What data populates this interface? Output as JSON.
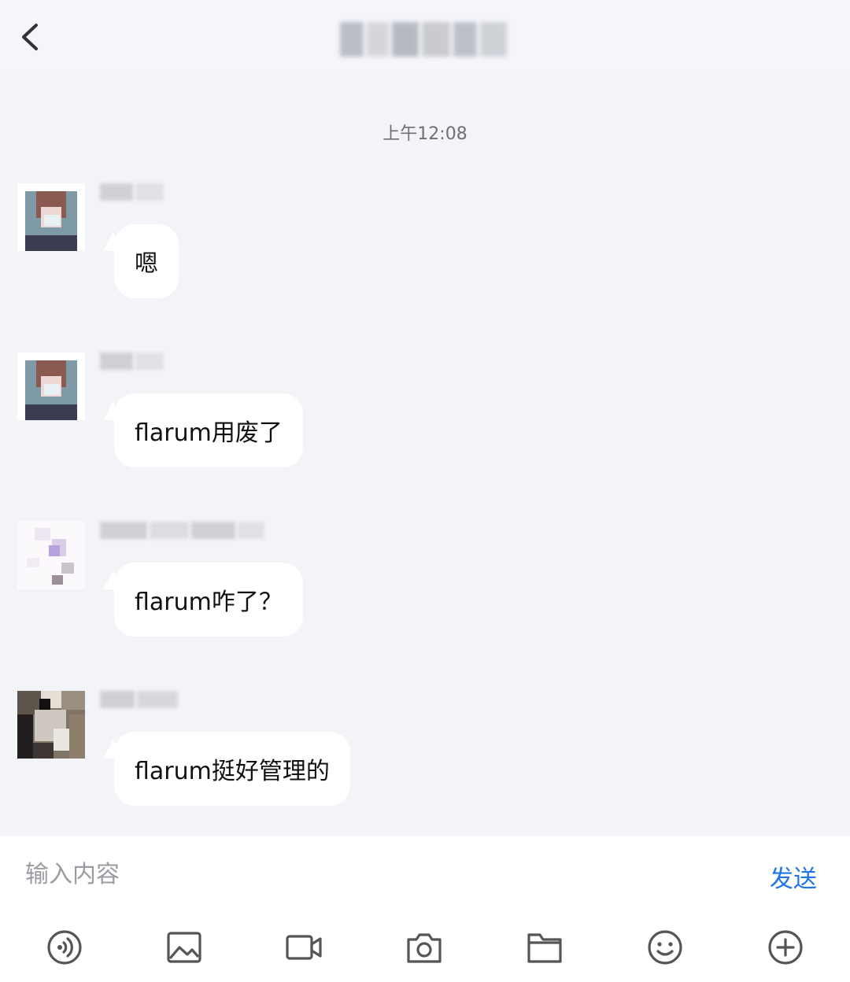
{
  "header": {
    "back_icon": "chevron-left-icon",
    "title": ""
  },
  "chat": {
    "timestamp": "上午12:08",
    "messages": [
      {
        "sender": "",
        "text": "嗯",
        "avatar": "avatar-1"
      },
      {
        "sender": "",
        "text": "flarum用废了",
        "avatar": "avatar-1"
      },
      {
        "sender": "",
        "text": "flarum咋了？",
        "avatar": "avatar-2"
      },
      {
        "sender": "",
        "text": "flarum挺好管理的",
        "avatar": "avatar-3"
      }
    ]
  },
  "composer": {
    "placeholder": "输入内容",
    "value": "",
    "send_label": "发送",
    "send_color": "#1f74e8"
  },
  "toolbar": {
    "icons": [
      "voice-icon",
      "image-icon",
      "video-icon",
      "camera-icon",
      "folder-icon",
      "emoji-icon",
      "plus-icon"
    ]
  }
}
